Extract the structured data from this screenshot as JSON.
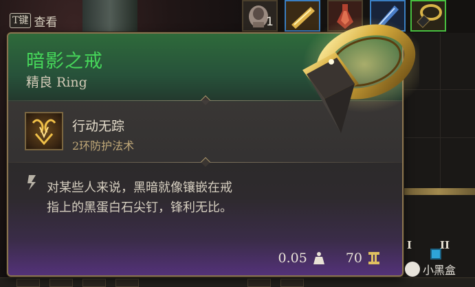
{
  "keyhint": {
    "key_label": "T键",
    "action_label": "查看"
  },
  "top_slots": [
    {
      "icon": "ring-item-icon",
      "count": "1",
      "border": "default"
    },
    {
      "icon": "scroll-item-icon",
      "count": "",
      "border": "blue"
    },
    {
      "icon": "potion-item-icon",
      "count": "",
      "border": "default"
    },
    {
      "icon": "crystal-item-icon",
      "count": "",
      "border": "blue"
    },
    {
      "icon": "shadow-ring-item-icon",
      "count": "",
      "border": "green"
    }
  ],
  "tooltip": {
    "item_name": "暗影之戒",
    "rarity_type": "精良 Ring",
    "spell": {
      "name": "行动无踪",
      "type": "2环防护法术",
      "icon": "spell-rune-icon"
    },
    "flavor_lines": [
      "对某些人来说，黑暗就像镶嵌在戒",
      "指上的黑蛋白石尖钉，锋利无比。"
    ],
    "weight": "0.05",
    "weight_icon": "weight-icon",
    "value": "70",
    "value_icon": "gold-coin-icon",
    "name_color": "#46d65a"
  },
  "side_labels": [
    "I",
    "II"
  ],
  "watermark": {
    "text": "小黑盒"
  }
}
